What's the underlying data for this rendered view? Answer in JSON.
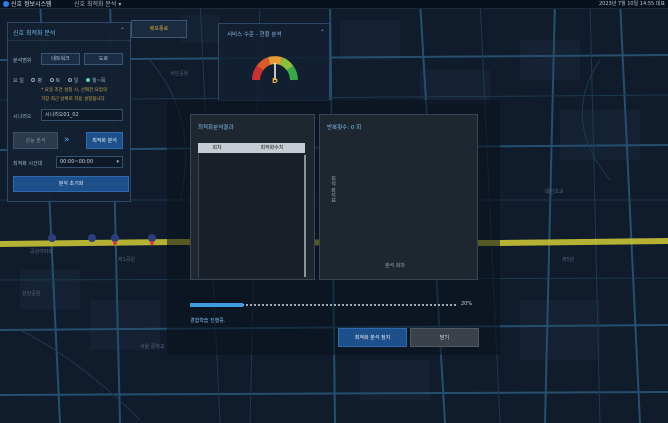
{
  "topbar": {
    "app_title": "신호 정보시스템",
    "menu_title": "신호 최적화 분석",
    "datetime": "2023년 7월 10일 14:55 대표"
  },
  "left_panel": {
    "title": "신호 최적화 분석",
    "toggle_icon": "chevron-up-icon",
    "range_label": "분석범위",
    "network_button": "네트워크",
    "road_button": "도로",
    "weather_label": "요 일",
    "weather_options": [
      "평",
      "토",
      "일",
      "월~목"
    ],
    "selected_option": "월~목",
    "note_line1": "* 요일 조건 설정 시, 선택한 요일의",
    "note_line2": "가장 최근 날짜로 자동 설정됩니다.",
    "scenario_label": "시나리오",
    "scenario_value": "시나리오01_02",
    "compare_button": "성능 분석",
    "optimize_button": "최적화 분석",
    "time_label": "최적화 시간대",
    "time_value": "00:00~00:00",
    "reset_button": "분석 초기화"
  },
  "report_tab": "배포종료",
  "service_panel": {
    "title": "서비스 수준 - 현황 분석",
    "grade": "D",
    "toggle_icon": "chevron-up-icon",
    "grade_level": 0.5
  },
  "dialog": {
    "result_title": "최적화분석결과",
    "columns": [
      "회차",
      "최적화수치"
    ],
    "chart_title": "반복횟수: 0 회",
    "y_axis_label": "최적 화지표",
    "x_axis_label": "분석 회차",
    "progress_value": 0.2,
    "progress_percent": "20%",
    "status_text": "경험학습 진행중.",
    "stop_button": "최적화 분석 정지",
    "close_button": "닫기"
  },
  "map_labels": {
    "label_1": "공원아파트",
    "label_2": "제1공원",
    "label_3": "서울 중학교",
    "label_4": "제5원",
    "label_5": "강당공원",
    "label_6": "대한초교",
    "label_7": "서민공원"
  },
  "colors": {
    "accent": "#3d9de0",
    "highway": "#c8c233",
    "road": "#2a5a7a",
    "grade_color": "#e8b13a"
  }
}
